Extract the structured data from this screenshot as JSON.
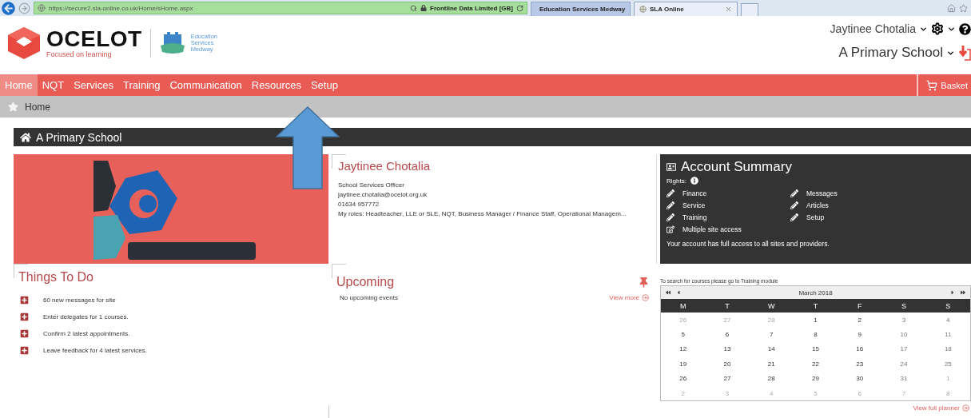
{
  "browser": {
    "url": "https://secure2.sla-online.co.uk/Home/sHome.aspx",
    "site_identity": "Frontline Data Limited [GB]",
    "tabs": [
      {
        "label": "Education Services Medway",
        "selected": false
      },
      {
        "label": "SLA Online",
        "selected": true
      }
    ]
  },
  "header": {
    "logo": {
      "name": "OCELOT",
      "tagline": "Focused on learning"
    },
    "partner_logo": [
      "Education",
      "Services",
      "Medway"
    ],
    "user": "Jaytinee Chotalia",
    "school": "A Primary School"
  },
  "nav": {
    "items": [
      {
        "label": "Home",
        "selected": true
      },
      {
        "label": "NQT",
        "selected": false
      },
      {
        "label": "Services",
        "selected": false
      },
      {
        "label": "Training",
        "selected": false
      },
      {
        "label": "Communication",
        "selected": false
      },
      {
        "label": "Resources",
        "selected": false
      },
      {
        "label": "Setup",
        "selected": false
      }
    ],
    "basket": "Basket"
  },
  "breadcrumb": [
    "Home"
  ],
  "page_title": "A Primary School",
  "banner": {
    "kind": "picture"
  },
  "profile": {
    "name": "Jaytinee Chotalia",
    "role": "School Services Officer",
    "email": "jaytinee.chotalia@ocelot.org.uk",
    "phone": "01634 957772",
    "roles": "My roles: Headteacher, LLE or SLE, NQT, Business Manager / Finance Staff, Operational Managem..."
  },
  "account_summary": {
    "title": "Account Summary",
    "rights_label": "Rights:",
    "rights": [
      {
        "label": "Finance",
        "kind": "edit"
      },
      {
        "label": "Messages",
        "kind": "edit"
      },
      {
        "label": "Service",
        "kind": "edit"
      },
      {
        "label": "Articles",
        "kind": "edit"
      },
      {
        "label": "Training",
        "kind": "edit"
      },
      {
        "label": "Setup",
        "kind": "edit"
      },
      {
        "label": "Multiple site access",
        "kind": "access"
      }
    ],
    "note": "Your account has full access to all sites and providers."
  },
  "things_to_do": {
    "title": "Things To Do",
    "items": [
      "60 new messages for site",
      "Enter delegates for 1 courses.",
      "Confirm 2 latest appointments.",
      "Leave feedback for 4 latest services."
    ]
  },
  "upcoming": {
    "title": "Upcoming",
    "empty": "No upcoming events",
    "link": "View more"
  },
  "calendar": {
    "hint": "To search for courses please go to Training module",
    "month": "March 2018",
    "weekdays": [
      "M",
      "T",
      "W",
      "T",
      "F",
      "S",
      "S"
    ],
    "weeks": [
      [
        {
          "day": "26",
          "muted": true
        },
        {
          "day": "27",
          "muted": true
        },
        {
          "day": "28",
          "muted": true
        },
        {
          "day": "1",
          "muted": false
        },
        {
          "day": "2",
          "muted": false
        },
        {
          "day": "3",
          "muted": false
        },
        {
          "day": "4",
          "muted": false
        }
      ],
      [
        {
          "day": "5",
          "muted": false
        },
        {
          "day": "6",
          "muted": false
        },
        {
          "day": "7",
          "muted": false
        },
        {
          "day": "8",
          "muted": false
        },
        {
          "day": "9",
          "muted": false
        },
        {
          "day": "10",
          "muted": false
        },
        {
          "day": "11",
          "muted": false
        }
      ],
      [
        {
          "day": "12",
          "muted": false
        },
        {
          "day": "13",
          "muted": false
        },
        {
          "day": "14",
          "muted": false
        },
        {
          "day": "15",
          "muted": false
        },
        {
          "day": "16",
          "muted": false
        },
        {
          "day": "17",
          "muted": false
        },
        {
          "day": "18",
          "muted": false
        }
      ],
      [
        {
          "day": "19",
          "muted": false
        },
        {
          "day": "20",
          "muted": false
        },
        {
          "day": "21",
          "muted": false
        },
        {
          "day": "22",
          "muted": false
        },
        {
          "day": "23",
          "muted": false
        },
        {
          "day": "24",
          "muted": false
        },
        {
          "day": "25",
          "muted": false
        }
      ],
      [
        {
          "day": "26",
          "muted": false
        },
        {
          "day": "27",
          "muted": false
        },
        {
          "day": "28",
          "muted": false
        },
        {
          "day": "29",
          "muted": false
        },
        {
          "day": "30",
          "muted": false
        },
        {
          "day": "31",
          "muted": false
        },
        {
          "day": "1",
          "muted": true
        }
      ],
      [
        {
          "day": "2",
          "muted": true
        },
        {
          "day": "3",
          "muted": true
        },
        {
          "day": "4",
          "muted": true
        },
        {
          "day": "5",
          "muted": true
        },
        {
          "day": "6",
          "muted": true
        },
        {
          "day": "7",
          "muted": true
        },
        {
          "day": "8",
          "muted": true
        }
      ]
    ],
    "link": "View full planner"
  }
}
